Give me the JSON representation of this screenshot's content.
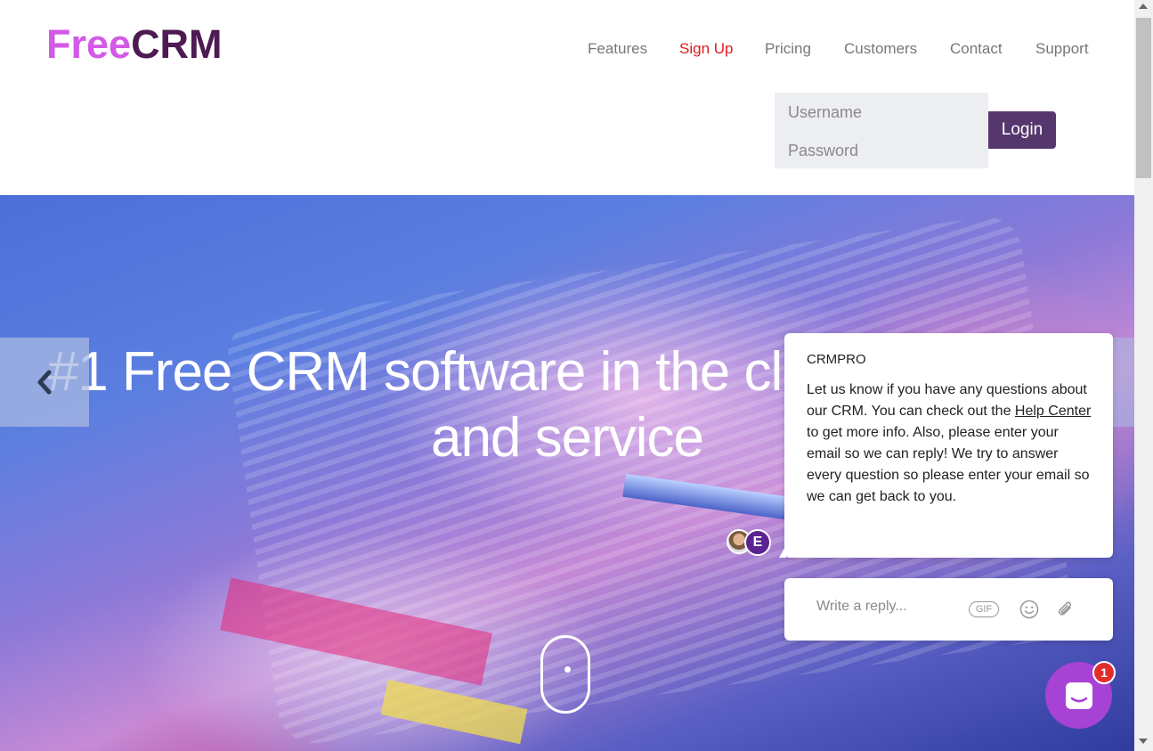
{
  "logo": {
    "part1": "Free",
    "part2": "CRM"
  },
  "nav": {
    "items": [
      {
        "label": "Features"
      },
      {
        "label": "Sign Up"
      },
      {
        "label": "Pricing"
      },
      {
        "label": "Customers"
      },
      {
        "label": "Contact"
      },
      {
        "label": "Support"
      }
    ]
  },
  "login": {
    "username_placeholder": "Username",
    "password_placeholder": "Password",
    "button_label": "Login"
  },
  "hero": {
    "title_line1": "#1 Free CRM software in the cloud for sales",
    "title_line2": "and service",
    "prev_icon": "chevron-left-icon",
    "scroll_icon": "mouse-scroll-icon"
  },
  "chat": {
    "sender": "CRMPRO",
    "message_part1": "Let us know if you have any questions about our CRM.  You can check out the ",
    "message_link": "Help Center",
    "message_part2": " to get more info.   Also, please enter your email so we can reply!  We try to answer every question so please enter your email so we can get back to you.",
    "avatar_initial": "E",
    "reply_placeholder": "Write a reply...",
    "gif_label": "GIF",
    "unread_count": "1"
  },
  "colors": {
    "logo_free": "#d35ae6",
    "logo_crm": "#4d1a52",
    "signup": "#e21b1b",
    "login_button": "#56376d",
    "launcher": "#a642d4",
    "badge": "#e22d2d"
  }
}
